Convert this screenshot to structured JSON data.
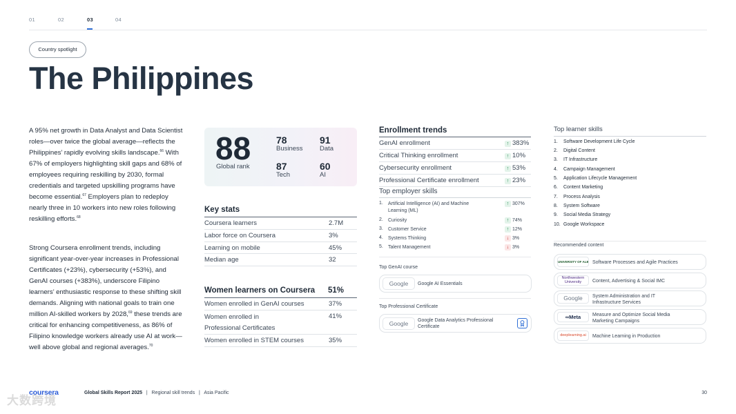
{
  "nav": {
    "tabs": [
      "01",
      "02",
      "03",
      "04"
    ],
    "active": "03"
  },
  "pill": "Country spotlight",
  "title": "The Philippines",
  "body": {
    "p1_a": "A 95% net growth in Data Analyst and Data Scientist roles—over twice the global average—reflects the Philippines’ rapidly evolving skills landscape.",
    "p1_ref1": "66",
    "p1_b": " With 67% of employers highlighting skill gaps and 68% of employees requiring reskilling by 2030, formal credentials and targeted upskilling programs have become essential.",
    "p1_ref2": "67",
    "p1_c": " Employers plan to redeploy nearly three in 10 workers into new roles following reskilling efforts.",
    "p1_ref3": "68",
    "p2_a": "Strong Coursera enrollment trends, including significant year-over-year increases in Professional Certificates (+23%), cybersecurity (+53%), and GenAI courses (+383%), underscore Filipino learners’ enthusiastic response to these shifting skill demands. Aligning with national goals to train one million AI-skilled workers by 2028,",
    "p2_ref1": "69",
    "p2_b": " these trends are critical for enhancing competitiveness, as 86% of Filipino knowledge workers already use AI at work—well above global and regional averages.",
    "p2_ref2": "70"
  },
  "rank": {
    "global": {
      "value": "88",
      "label": "Global rank"
    },
    "business": {
      "value": "78",
      "label": "Business"
    },
    "data": {
      "value": "91",
      "label": "Data"
    },
    "tech": {
      "value": "87",
      "label": "Tech"
    },
    "ai": {
      "value": "60",
      "label": "AI"
    }
  },
  "key_stats": {
    "heading": "Key stats",
    "rows": [
      {
        "label": "Coursera learners",
        "value": "2.7M"
      },
      {
        "label": "Labor force on Coursera",
        "value": "3%"
      },
      {
        "label": "Learning on mobile",
        "value": "45%"
      },
      {
        "label": "Median age",
        "value": "32"
      }
    ]
  },
  "women": {
    "heading": "Women learners on Coursera",
    "heading_value": "51%",
    "rows": [
      {
        "label": "Women enrolled in GenAI courses",
        "value": "37%"
      },
      {
        "label": "Women enrolled in Professional Certificates",
        "value": "41%"
      },
      {
        "label": "Women enrolled in STEM courses",
        "value": "35%"
      }
    ]
  },
  "enrollment": {
    "heading": "Enrollment trends",
    "rows": [
      {
        "label": "GenAI enrollment",
        "value": "383%",
        "dir": "up"
      },
      {
        "label": "Critical Thinking enrollment",
        "value": "10%",
        "dir": "up"
      },
      {
        "label": "Cybersecurity enrollment",
        "value": "53%",
        "dir": "up"
      },
      {
        "label": "Professional Certificate enrollment",
        "value": "23%",
        "dir": "up"
      }
    ]
  },
  "employer_skills": {
    "heading": "Top employer skills",
    "rows": [
      {
        "index": "1.",
        "label": "Artificial Intelligence (AI) and Machine Learning (ML)",
        "value": "307%",
        "dir": "up"
      },
      {
        "index": "2.",
        "label": "Curiosity",
        "value": "74%",
        "dir": "up"
      },
      {
        "index": "3.",
        "label": "Customer Service",
        "value": "12%",
        "dir": "up"
      },
      {
        "index": "4.",
        "label": "Systems Thinking",
        "value": "3%",
        "dir": "down"
      },
      {
        "index": "5.",
        "label": "Talent Management",
        "value": "3%",
        "dir": "down"
      }
    ]
  },
  "genai_course": {
    "heading": "Top GenAI course",
    "logo": "Google",
    "title": "Google AI Essentials"
  },
  "prof_cert": {
    "heading": "Top Professional Certificate",
    "logo": "Google",
    "title": "Google Data Analytics Professional Certificate"
  },
  "learner_skills": {
    "heading": "Top learner skills",
    "items": [
      {
        "index": "1.",
        "label": "Software Development Life Cycle"
      },
      {
        "index": "2.",
        "label": "Digital Content"
      },
      {
        "index": "3.",
        "label": "IT Infrastructure"
      },
      {
        "index": "4.",
        "label": "Campaign Management"
      },
      {
        "index": "5.",
        "label": "Application Lifecycle Management"
      },
      {
        "index": "6.",
        "label": "Content Marketing"
      },
      {
        "index": "7.",
        "label": "Process Analysis"
      },
      {
        "index": "8.",
        "label": "System Software"
      },
      {
        "index": "9.",
        "label": "Social Media Strategy"
      },
      {
        "index": "10.",
        "label": "Google Workspace"
      }
    ]
  },
  "recommended": {
    "heading": "Recommended content",
    "items": [
      {
        "logo": "UNIVERSITY OF ALBERTA",
        "title": "Software Processes and Agile Practices"
      },
      {
        "logo": "Northwestern University",
        "title": "Content, Advertising & Social IMC"
      },
      {
        "logo": "Google",
        "title": "System Administration and IT Infrastructure Services"
      },
      {
        "logo": "∞Meta",
        "title": "Measure and Optimize Social Media Marketing Campaigns"
      },
      {
        "logo": "deeplearning.ai",
        "title": "Machine Learning in Production"
      }
    ]
  },
  "footer": {
    "brand": "coursera",
    "report": "Global Skills Report 2025",
    "sep": "|",
    "section": "Regional skill trends",
    "region": "Asia Pacific",
    "page": "30"
  },
  "watermark": "大数跨境",
  "colors": {
    "accent": "#2f6fd6",
    "up": "#1e8a4c",
    "down": "#c53030",
    "brand": "#2a5bd7"
  }
}
